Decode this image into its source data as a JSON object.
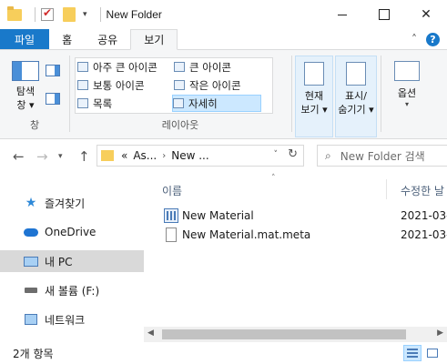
{
  "window": {
    "title": "New Folder",
    "controls": {
      "minimize": "",
      "maximize": "",
      "close": "✕"
    }
  },
  "ribbon_tabs": [
    {
      "label": "파일"
    },
    {
      "label": "홈"
    },
    {
      "label": "공유"
    },
    {
      "label": "보기",
      "active": true
    }
  ],
  "ribbon": {
    "window_group": {
      "nav_pane_label_1": "탐색",
      "nav_pane_label_2": "창 ▾",
      "group_label": "창"
    },
    "layout_group": {
      "items": [
        {
          "label": "아주 큰 아이콘"
        },
        {
          "label": "큰 아이콘"
        },
        {
          "label": "보통 아이콘"
        },
        {
          "label": "작은 아이콘"
        },
        {
          "label": "목록"
        },
        {
          "label": "자세히",
          "selected": true
        }
      ],
      "group_label": "레이아웃"
    },
    "current_view": {
      "label_1": "현재",
      "label_2": "보기 ▾"
    },
    "show_hide": {
      "label_1": "표시/",
      "label_2": "숨기기 ▾"
    },
    "options": {
      "label": "옵션",
      "caret": "▾"
    }
  },
  "address": {
    "crumbs": [
      "«",
      "As...",
      "›",
      "New ..."
    ],
    "search_placeholder": "New Folder 검색"
  },
  "nav_pane": [
    {
      "label": "즐겨찾기",
      "icon": "star-icon"
    },
    {
      "label": "OneDrive",
      "icon": "cloud-icon"
    },
    {
      "label": "내 PC",
      "icon": "pc-icon",
      "selected": true
    },
    {
      "label": "새 볼륨 (F:)",
      "icon": "drive-icon"
    },
    {
      "label": "네트워크",
      "icon": "network-icon"
    }
  ],
  "file_list": {
    "columns": {
      "name": "이름",
      "modified": "수정한 날"
    },
    "rows": [
      {
        "name": "New Material",
        "date": "2021-03-",
        "icon": "material-icon"
      },
      {
        "name": "New Material.mat.meta",
        "date": "2021-03-",
        "icon": "document-icon"
      }
    ]
  },
  "status": {
    "item_count": "2개 항목"
  },
  "colors": {
    "file_tab": "#1979ca",
    "selection": "#cce8ff",
    "ribbon_bg": "#f5f6f7"
  }
}
